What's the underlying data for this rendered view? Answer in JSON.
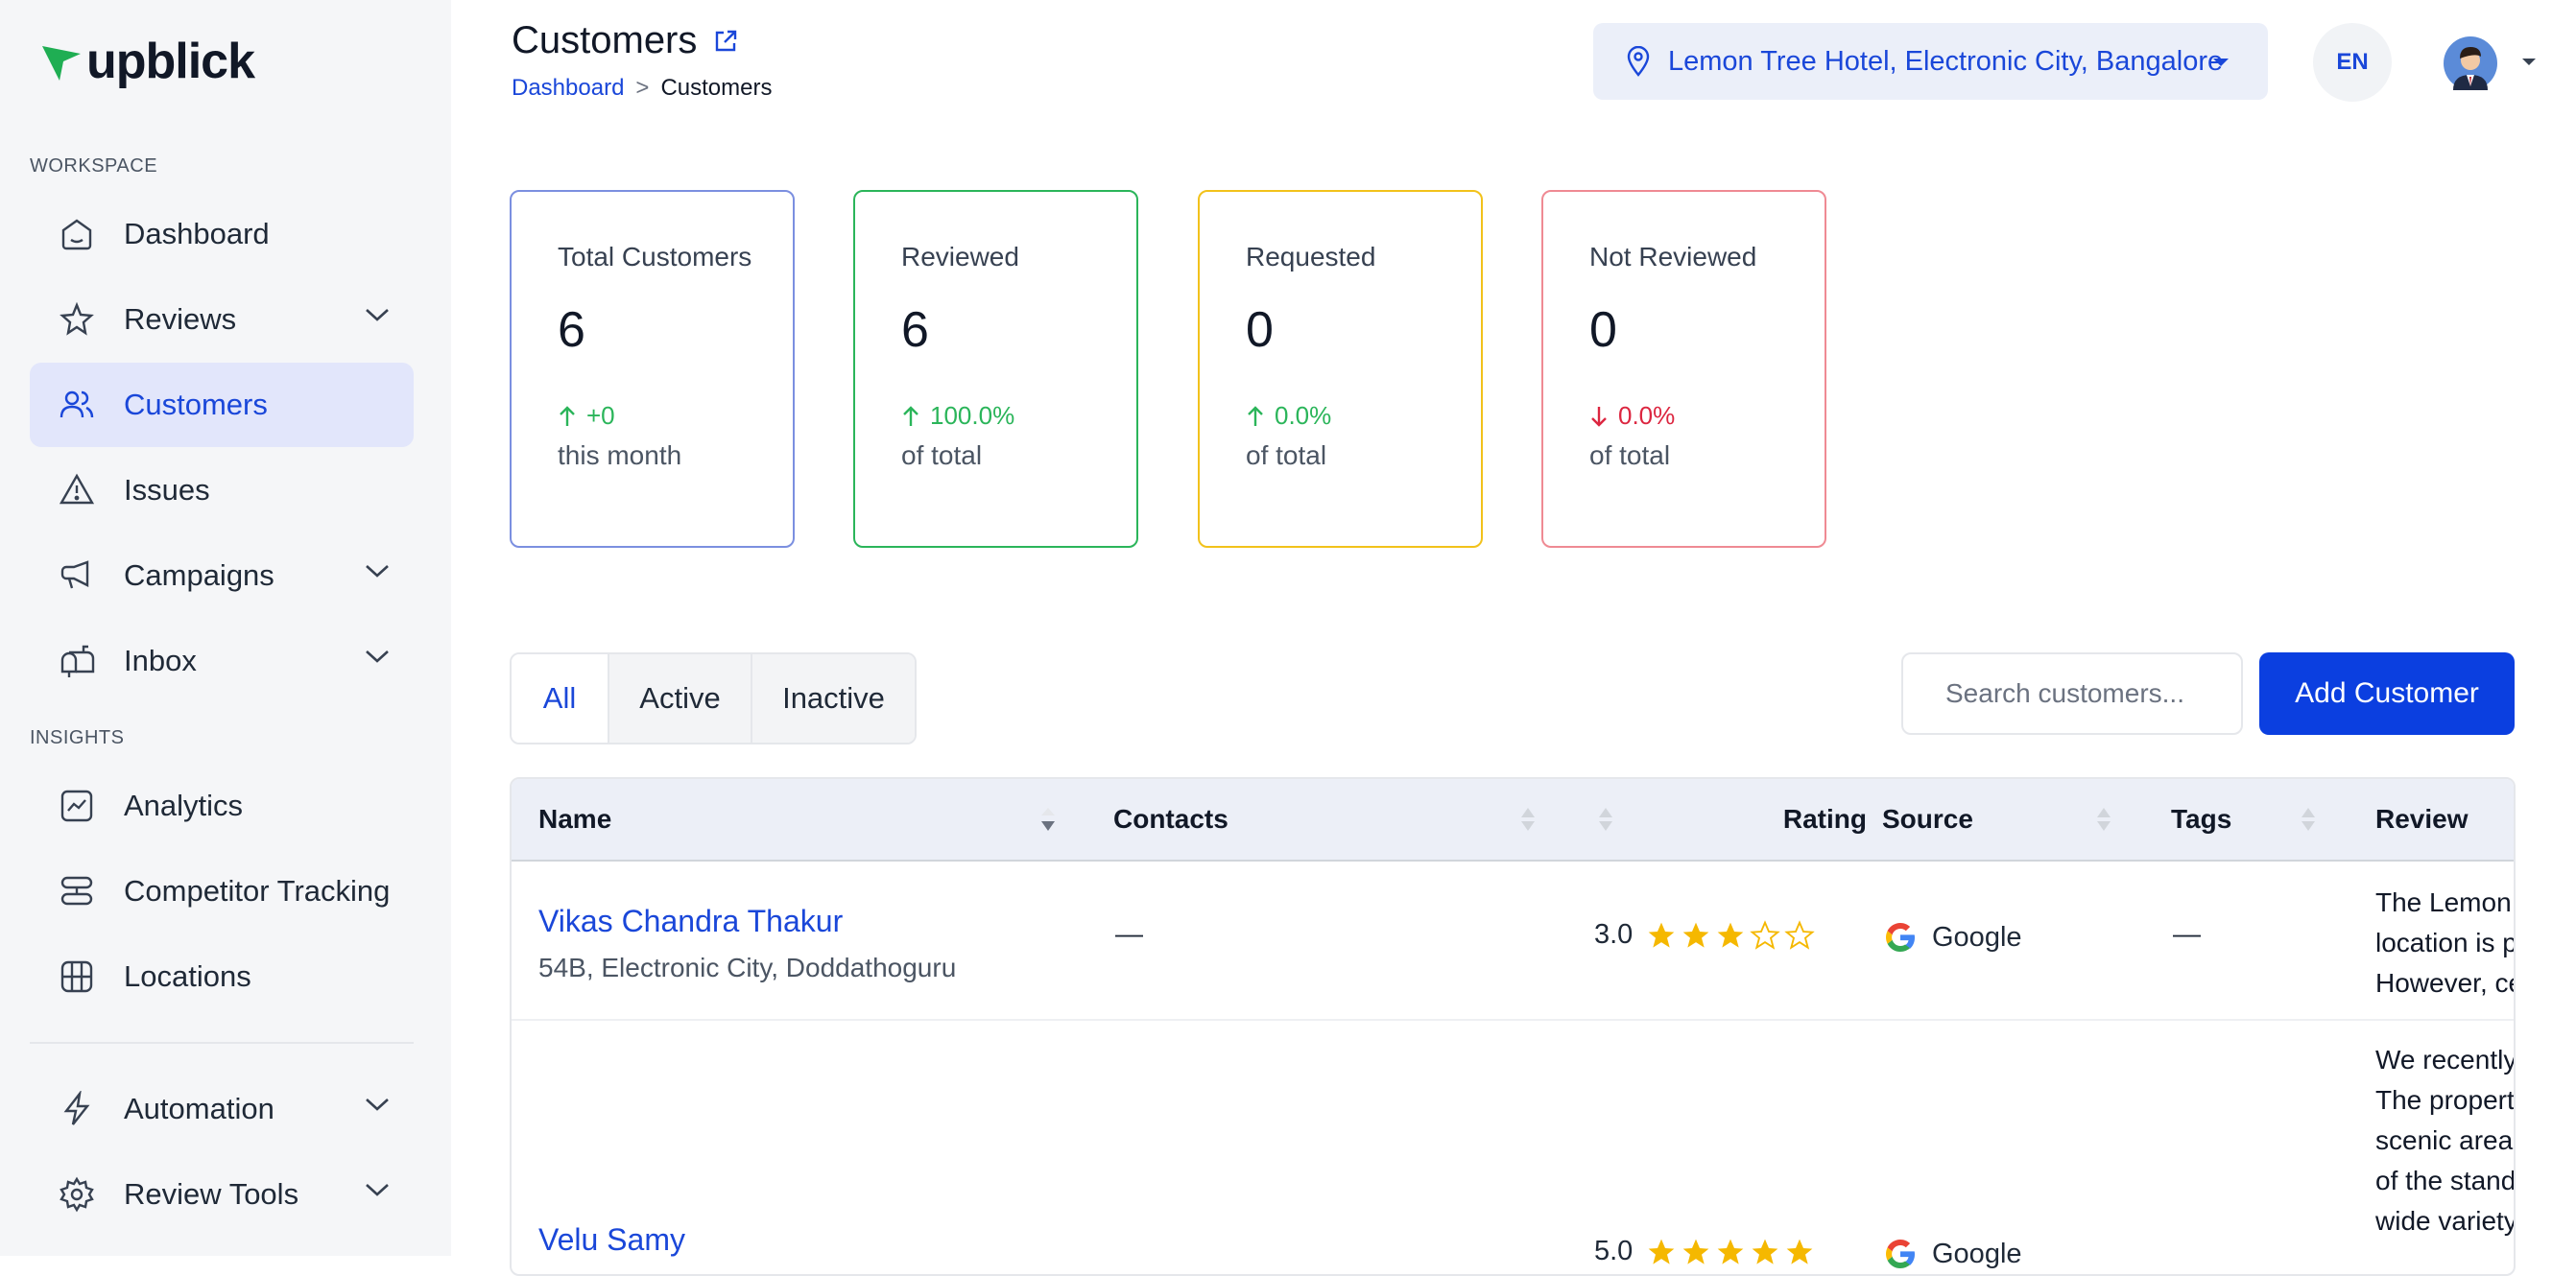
{
  "brand": {
    "name": "upblick",
    "accent": "#1a47d9",
    "logo_color": "#1fae53"
  },
  "sidebar": {
    "sections": {
      "workspace": "WORKSPACE",
      "insights": "INSIGHTS"
    },
    "items": [
      {
        "label": "Dashboard",
        "icon": "home-icon"
      },
      {
        "label": "Reviews",
        "icon": "star-badge-icon",
        "expandable": true
      },
      {
        "label": "Customers",
        "icon": "users-icon",
        "active": true
      },
      {
        "label": "Issues",
        "icon": "alert-triangle-icon"
      },
      {
        "label": "Campaigns",
        "icon": "megaphone-icon",
        "expandable": true
      },
      {
        "label": "Inbox",
        "icon": "mailbox-icon",
        "expandable": true
      },
      {
        "label": "Analytics",
        "icon": "trend-chart-icon"
      },
      {
        "label": "Competitor Tracking",
        "icon": "versus-icon"
      },
      {
        "label": "Locations",
        "icon": "map-icon"
      },
      {
        "label": "Automation",
        "icon": "lightning-icon",
        "expandable": true
      },
      {
        "label": "Review Tools",
        "icon": "gear-icon",
        "expandable": true
      }
    ]
  },
  "header": {
    "title": "Customers",
    "breadcrumb": {
      "parent": "Dashboard",
      "separator": ">",
      "current": "Customers"
    },
    "location": "Lemon Tree Hotel, Electronic City, Bangalore",
    "language": "EN"
  },
  "stats": [
    {
      "label": "Total Customers",
      "value": "6",
      "trend": "+0",
      "trend_dir": "up",
      "sub": "this month",
      "color": "#7b8fe0"
    },
    {
      "label": "Reviewed",
      "value": "6",
      "trend": "100.0%",
      "trend_dir": "up",
      "sub": "of total",
      "color": "#2bb55a"
    },
    {
      "label": "Requested",
      "value": "0",
      "trend": "0.0%",
      "trend_dir": "up",
      "sub": "of total",
      "color": "#f2c21b"
    },
    {
      "label": "Not Reviewed",
      "value": "0",
      "trend": "0.0%",
      "trend_dir": "down",
      "sub": "of total",
      "color": "#ef8a93"
    }
  ],
  "tabs": [
    {
      "label": "All",
      "active": true
    },
    {
      "label": "Active"
    },
    {
      "label": "Inactive"
    }
  ],
  "search": {
    "placeholder": "Search customers..."
  },
  "add_button": "Add Customer",
  "table": {
    "columns": [
      "Name",
      "Contacts",
      "Rating",
      "Source",
      "Tags",
      "Review"
    ],
    "rows": [
      {
        "name": "Vikas Chandra Thakur",
        "address": "54B, Electronic City, Doddathoguru",
        "contacts": "—",
        "rating": "3.0",
        "stars": 3,
        "source": "Google",
        "tags": "—",
        "review_lines": [
          "The Lemon",
          "location is p",
          "However, ce"
        ]
      },
      {
        "name": "Velu Samy",
        "rating": "5.0",
        "stars": 5,
        "source": "Google",
        "review_lines": [
          "We recently",
          "The propert",
          "scenic area,",
          "of the stand",
          "wide variety"
        ]
      }
    ]
  }
}
